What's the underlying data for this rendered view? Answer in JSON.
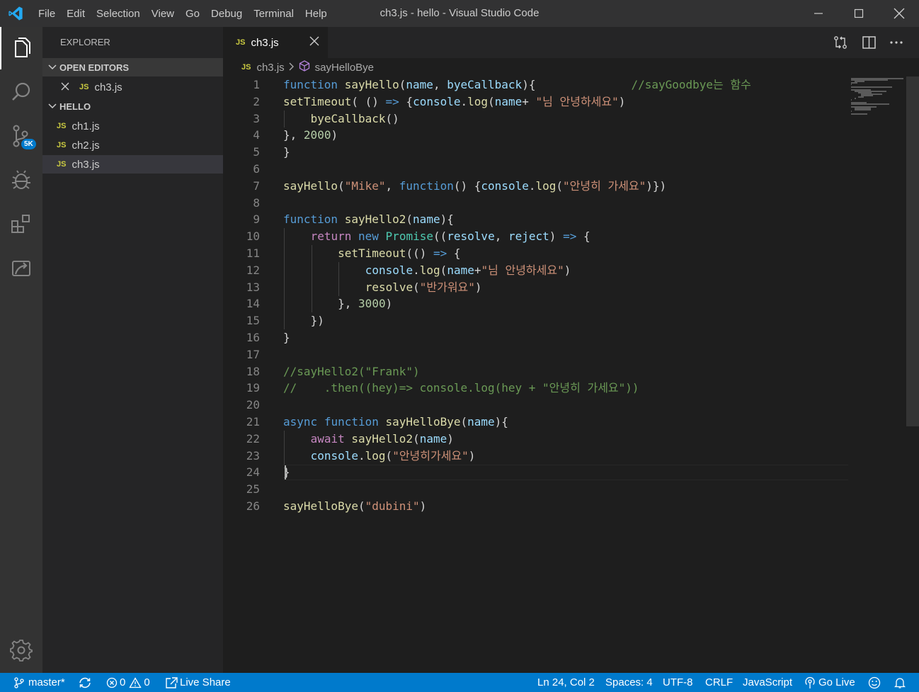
{
  "window": {
    "title": "ch3.js - hello - Visual Studio Code",
    "menu": [
      "File",
      "Edit",
      "Selection",
      "View",
      "Go",
      "Debug",
      "Terminal",
      "Help"
    ]
  },
  "activity_bar": {
    "items": [
      "explorer-icon",
      "search-icon",
      "source-control-icon",
      "debug-icon",
      "extensions-icon",
      "remote-explorer-icon"
    ],
    "scm_badge": "5K",
    "accent": "#007acc"
  },
  "sidebar": {
    "title": "EXPLORER",
    "open_editors": {
      "header": "OPEN EDITORS",
      "items": [
        {
          "icon": "JS",
          "label": "ch3.js"
        }
      ]
    },
    "folder": {
      "header": "HELLO",
      "files": [
        {
          "icon": "JS",
          "label": "ch1.js"
        },
        {
          "icon": "JS",
          "label": "ch2.js"
        },
        {
          "icon": "JS",
          "label": "ch3.js",
          "selected": true
        }
      ]
    }
  },
  "tabs": [
    {
      "icon": "JS",
      "label": "ch3.js",
      "active": true
    }
  ],
  "breadcrumb": {
    "icon": "JS",
    "file": "ch3.js",
    "symbol": "sayHelloBye"
  },
  "editor": {
    "lines": [
      "function sayHello(name, byeCallback){              //sayGoodbye는 함수",
      "setTimeout( () => {console.log(name+ \"님 안녕하세요\")",
      "    byeCallback()",
      "}, 2000)",
      "}",
      "",
      "sayHello(\"Mike\", function() {console.log(\"안녕히 가세요\")})",
      "",
      "function sayHello2(name){",
      "    return new Promise((resolve, reject) => {",
      "        setTimeout(() => {",
      "            console.log(name+\"님 안녕하세요\")",
      "            resolve(\"반가워요\")",
      "        }, 3000)",
      "    })",
      "}",
      "",
      "//sayHello2(\"Frank\")",
      "//    .then((hey)=> console.log(hey + \"안녕히 가세요\"))",
      "",
      "async function sayHelloBye(name){",
      "    await sayHello2(name)",
      "    console.log(\"안녕히가세요\")",
      "}",
      "",
      "sayHelloBye(\"dubini\")"
    ]
  },
  "status_bar": {
    "branch": "master*",
    "errors": "0",
    "warnings": "0",
    "live_share": "Live Share",
    "position": "Ln 24, Col 2",
    "spaces": "Spaces: 4",
    "encoding": "UTF-8",
    "eol": "CRLF",
    "language": "JavaScript",
    "go_live": "Go Live"
  }
}
